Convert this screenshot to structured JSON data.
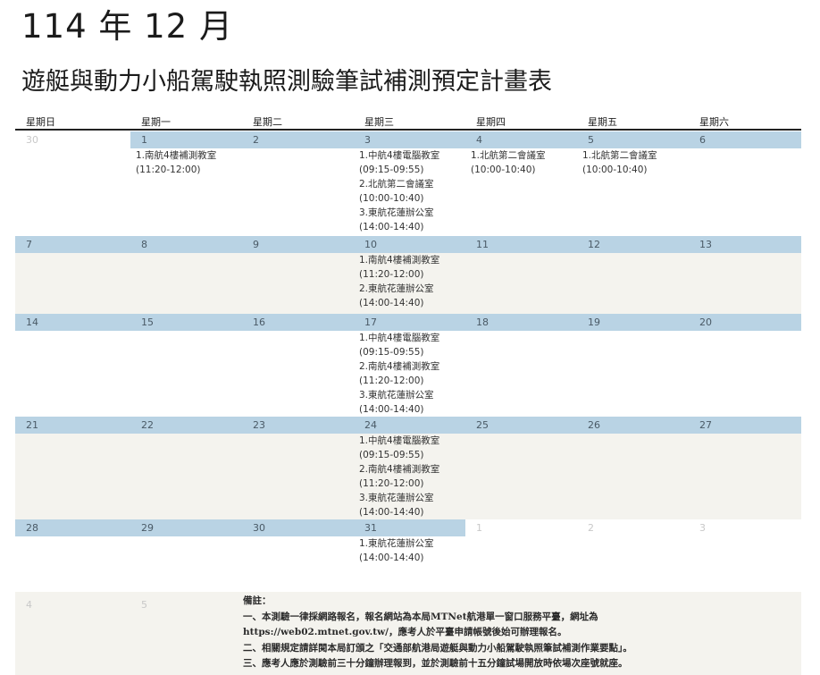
{
  "header": {
    "month": "114 年 12 月",
    "title": "遊艇與動力小船駕駛執照測驗筆試補測預定計畫表"
  },
  "weekdays": [
    "星期日",
    "星期一",
    "星期二",
    "星期三",
    "星期四",
    "星期五",
    "星期六"
  ],
  "weeks": [
    {
      "days": [
        {
          "num": "30",
          "in": false,
          "events": []
        },
        {
          "num": "1",
          "in": true,
          "events": [
            "1.南航4樓補測教室",
            "(11:20-12:00)"
          ]
        },
        {
          "num": "2",
          "in": true,
          "events": []
        },
        {
          "num": "3",
          "in": true,
          "events": [
            "1.中航4樓電腦教室",
            "(09:15-09:55)",
            "2.北航第二會議室",
            "(10:00-10:40)",
            "3.東航花蓮辦公室",
            "(14:00-14:40)"
          ]
        },
        {
          "num": "4",
          "in": true,
          "events": [
            "1.北航第二會議室",
            "(10:00-10:40)"
          ]
        },
        {
          "num": "5",
          "in": true,
          "events": [
            "1.北航第二會議室",
            "(10:00-10:40)"
          ]
        },
        {
          "num": "6",
          "in": true,
          "events": []
        }
      ]
    },
    {
      "days": [
        {
          "num": "7",
          "in": true,
          "events": []
        },
        {
          "num": "8",
          "in": true,
          "events": []
        },
        {
          "num": "9",
          "in": true,
          "events": []
        },
        {
          "num": "10",
          "in": true,
          "events": [
            "1.南航4樓補測教室",
            "(11:20-12:00)",
            "2.東航花蓮辦公室",
            "(14:00-14:40)"
          ]
        },
        {
          "num": "11",
          "in": true,
          "events": []
        },
        {
          "num": "12",
          "in": true,
          "events": []
        },
        {
          "num": "13",
          "in": true,
          "events": []
        }
      ]
    },
    {
      "days": [
        {
          "num": "14",
          "in": true,
          "events": []
        },
        {
          "num": "15",
          "in": true,
          "events": []
        },
        {
          "num": "16",
          "in": true,
          "events": []
        },
        {
          "num": "17",
          "in": true,
          "events": [
            "1.中航4樓電腦教室",
            "(09:15-09:55)",
            "2.南航4樓補測教室",
            "(11:20-12:00)",
            "3.東航花蓮辦公室",
            "(14:00-14:40)"
          ]
        },
        {
          "num": "18",
          "in": true,
          "events": []
        },
        {
          "num": "19",
          "in": true,
          "events": []
        },
        {
          "num": "20",
          "in": true,
          "events": []
        }
      ]
    },
    {
      "days": [
        {
          "num": "21",
          "in": true,
          "events": []
        },
        {
          "num": "22",
          "in": true,
          "events": []
        },
        {
          "num": "23",
          "in": true,
          "events": []
        },
        {
          "num": "24",
          "in": true,
          "events": [
            "1.中航4樓電腦教室",
            "(09:15-09:55)",
            "2.南航4樓補測教室",
            "(11:20-12:00)",
            "3.東航花蓮辦公室",
            "(14:00-14:40)"
          ]
        },
        {
          "num": "25",
          "in": true,
          "events": []
        },
        {
          "num": "26",
          "in": true,
          "events": []
        },
        {
          "num": "27",
          "in": true,
          "events": []
        }
      ]
    },
    {
      "days": [
        {
          "num": "28",
          "in": true,
          "events": []
        },
        {
          "num": "29",
          "in": true,
          "events": []
        },
        {
          "num": "30",
          "in": true,
          "events": []
        },
        {
          "num": "31",
          "in": true,
          "events": [
            "1.東航花蓮辦公室",
            "(14:00-14:40)"
          ]
        },
        {
          "num": "1",
          "in": false,
          "events": []
        },
        {
          "num": "2",
          "in": false,
          "events": []
        },
        {
          "num": "3",
          "in": false,
          "events": []
        }
      ]
    }
  ],
  "last_row": [
    "4",
    "5"
  ],
  "notes": {
    "heading": "備註：",
    "lines": [
      "一、本測驗一律採網路報名，報名網站為本局MTNet航港單一窗口服務平臺，網址為",
      "https://web02.mtnet.gov.tw/，應考人於平臺申請帳號後始可辦理報名。",
      "二、相關規定請詳閱本局訂頒之「交通部航港局遊艇與動力小船駕駛執照筆試補測作業要點」。",
      "三、應考人應於測驗前三十分鐘辦理報到，並於測驗前十五分鐘試場開放時依場次座號就座。"
    ]
  }
}
